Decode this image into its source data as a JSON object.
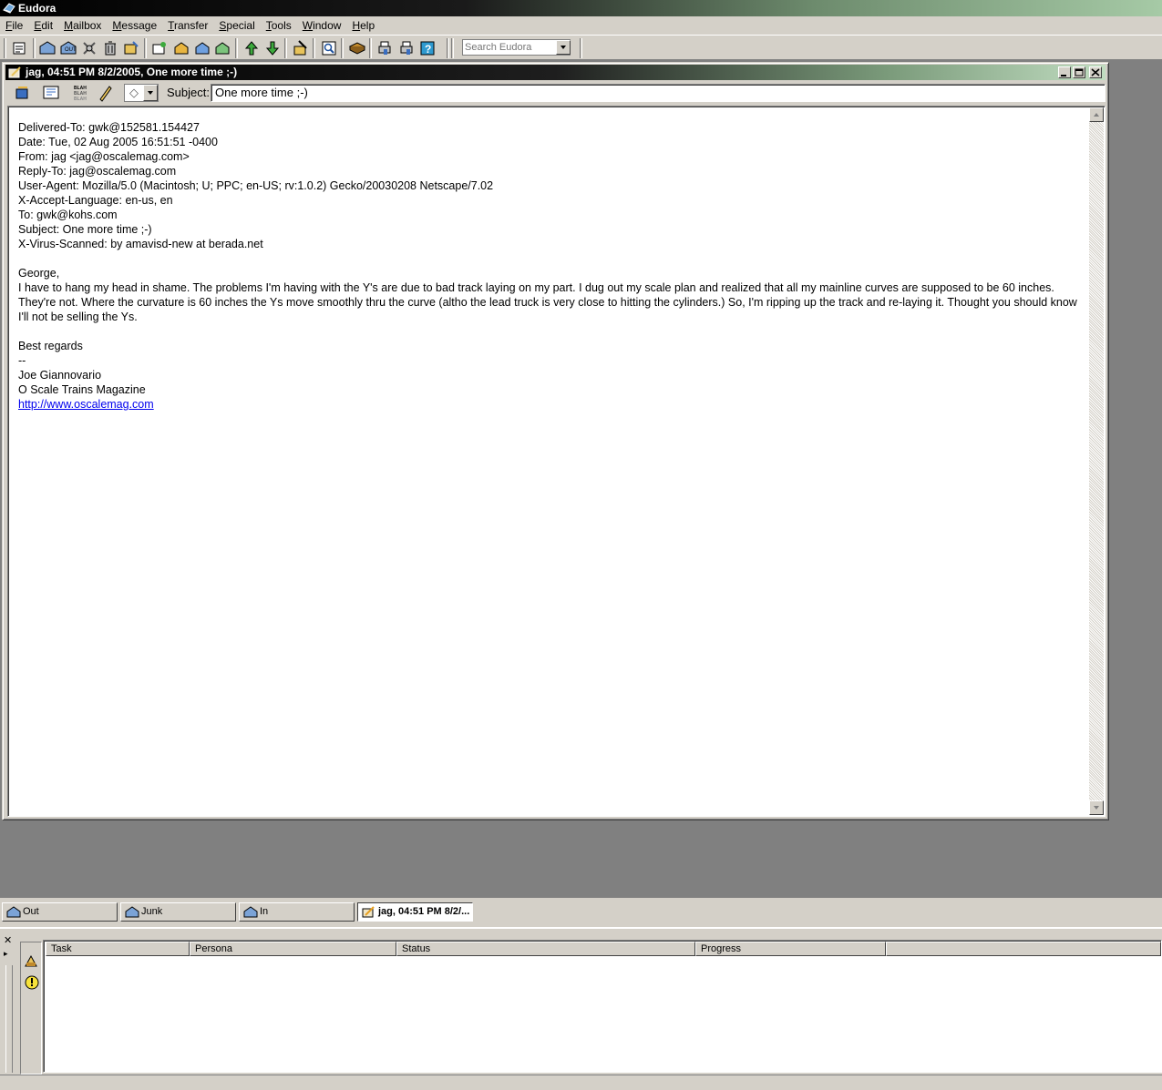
{
  "app": {
    "title": "Eudora"
  },
  "menu": [
    "File",
    "Edit",
    "Mailbox",
    "Message",
    "Transfer",
    "Special",
    "Tools",
    "Window",
    "Help"
  ],
  "search": {
    "placeholder": "Search Eudora"
  },
  "message_window": {
    "title": "jag, 04:51 PM 8/2/2005, One more time ;-)",
    "subject_label": "Subject:",
    "subject_value": "One more time ;-)",
    "priority_glyph": "◇"
  },
  "message": {
    "headers": [
      "Delivered-To: gwk@152581.154427",
      "Date: Tue, 02 Aug 2005 16:51:51 -0400",
      "From: jag <jag@oscalemag.com>",
      "Reply-To: jag@oscalemag.com",
      "User-Agent: Mozilla/5.0 (Macintosh; U; PPC; en-US; rv:1.0.2) Gecko/20030208 Netscape/7.02",
      "X-Accept-Language: en-us, en",
      "To: gwk@kohs.com",
      "Subject: One more time ;-)",
      "X-Virus-Scanned: by amavisd-new at berada.net"
    ],
    "greeting": "George,",
    "paragraph": "I have to hang my head in shame. The problems I'm having with the Y's are due to bad track laying on my part. I dug out my scale plan and realized that all my mainline curves are supposed to be 60 inches. They're not. Where the curvature is 60 inches the Ys move smoothly thru the curve (altho the lead truck is very close to hitting the cylinders.) So, I'm ripping up the track and re-laying it. Thought you should know I'll not be selling the Ys.",
    "closing": "Best regards",
    "sig_sep": "--",
    "sig_name": "Joe Giannovario",
    "sig_org": "O Scale Trains Magazine",
    "sig_link": "http://www.oscalemag.com"
  },
  "tabs": [
    {
      "label": "Out"
    },
    {
      "label": "Junk"
    },
    {
      "label": "In"
    },
    {
      "label": "jag, 04:51 PM 8/2/..."
    }
  ],
  "task_panel": {
    "columns": [
      "Task",
      "Persona",
      "Status",
      "Progress"
    ]
  },
  "colors": {
    "title_gradient_end": "#a6caa6",
    "workspace": "#808080",
    "link": "#0000ee"
  }
}
